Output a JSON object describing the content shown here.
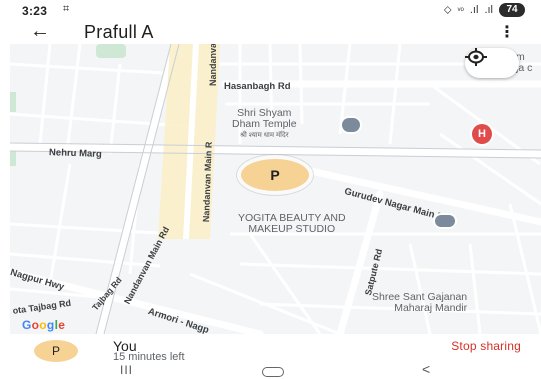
{
  "status_bar": {
    "time": "3:23",
    "cast_icon": "screen-cast-icon",
    "battery": "74",
    "icons": [
      "location-icon",
      "volte-icon",
      "signal-icon",
      "signal-icon",
      "battery-icon"
    ]
  },
  "app_bar": {
    "title": "Prafull A",
    "back_icon": "arrow-left-icon",
    "menu_icon": "more-vertical-icon"
  },
  "map": {
    "roads": {
      "nandanvan_main_1": "Nandanvan Main R",
      "hasanbagh": "Hasanbagh Rd",
      "nehru_marg": "Nehru Marg",
      "nandanvan_main_2": "Nandanvan Main R",
      "gurudev": "Gurudev Nagar Main Rd",
      "nandanvan_main_3": "Nandanvan Main Rd",
      "nagpur_hwy": "Nagpur Hwy",
      "armori": "Armori - Nagp",
      "sakkardara": "Satpute Rd",
      "tajbag": "ota Tajbag Rd",
      "tajbag2": "Tajbag Rd"
    },
    "pois": {
      "temple_line1": "Shri Shyam",
      "temple_line2": "Dham Temple",
      "temple_devanagari": "श्री श्याम धाम मंदिर",
      "yogita_line1": "YOGITA BEAUTY AND",
      "yogita_line2": "MAKEUP STUDIO",
      "gajanan_line1": "Shree Sant Gajanan",
      "gajanan_line2": "Maharaj Mandir",
      "corner_top": "m",
      "corner_top2": "ja c"
    },
    "hospital_label": "H",
    "user_marker_label": "P",
    "recenter_icon": "recenter-target-icon",
    "google_logo": [
      "G",
      "o",
      "o",
      "g",
      "l",
      "e"
    ]
  },
  "share_panel": {
    "avatar_label": "P",
    "name": "You",
    "status": "15 minutes left",
    "stop_label": "Stop sharing"
  },
  "nav_bar": {
    "recents": "III",
    "back": "<"
  }
}
